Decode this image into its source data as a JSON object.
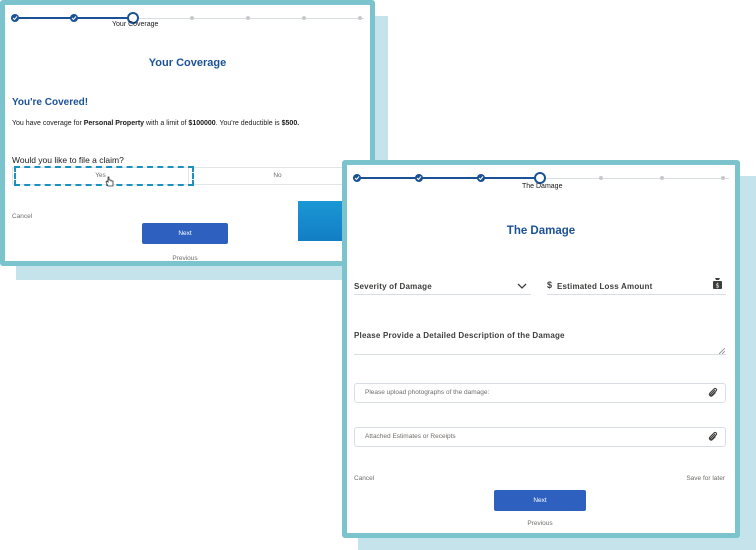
{
  "screen1": {
    "progress": {
      "current_step": "Your Coverage"
    },
    "title": "Your Coverage",
    "covered_heading": "You're Covered!",
    "coverage": {
      "prefix": "You have coverage for ",
      "type": "Personal Property",
      "middle": " with a limit of ",
      "limit": "$100000",
      "sep": ".  You're deductible is ",
      "deductible": "$500."
    },
    "question": "Would you like to file a claim?",
    "options": [
      "Yes",
      "No"
    ],
    "cancel": "Cancel",
    "next": "Next",
    "previous": "Previous"
  },
  "screen2": {
    "progress": {
      "current_step": "The Damage"
    },
    "title": "The Damage",
    "severity_label": "Severity of Damage",
    "loss_currency": "$",
    "loss_label": "Estimated Loss Amount",
    "description_label": "Please Provide a Detailed Description of the Damage",
    "upload_photos": "Please upload photographs of the damage:",
    "upload_estimates": "Attached Estimates or Receipts",
    "cancel": "Cancel",
    "save_later": "Save for later",
    "next": "Next",
    "previous": "Previous"
  },
  "colors": {
    "brand_blue": "#1b5297",
    "button_blue": "#2e61bf",
    "frame_teal": "#7cc4cd",
    "arrow_blue": "#1593d0",
    "focus": "#1a92c0"
  }
}
